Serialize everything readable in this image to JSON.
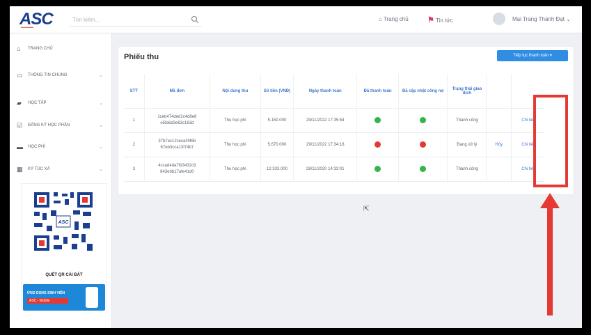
{
  "header": {
    "logo_text": "ASC",
    "search_placeholder": "Tìm kiếm...",
    "home_label": "Trang chủ",
    "news_label": "Tin tức",
    "user_name": "Mai Trang Thành Đạt"
  },
  "sidebar": {
    "items": [
      {
        "label": "Trang chủ",
        "icon": "home-icon",
        "has_chevron": false
      },
      {
        "label": "Thông tin chung",
        "icon": "monitor-icon",
        "has_chevron": true
      },
      {
        "label": "Học tập",
        "icon": "graduation-cap-icon",
        "has_chevron": true
      },
      {
        "label": "Đăng ký học phần",
        "icon": "register-icon",
        "has_chevron": true
      },
      {
        "label": "Học phí",
        "icon": "money-icon",
        "has_chevron": true
      },
      {
        "label": "Ký túc xá",
        "icon": "building-icon",
        "has_chevron": true
      }
    ],
    "qr_caption": "QUÉT QR CÀI ĐẶT",
    "banner_line1": "ỨNG DỤNG SINH VIÊN",
    "banner_line2": "ASC - Mobile"
  },
  "main": {
    "title": "Phiếu thu",
    "pay_button": "Tiếp tục thanh toán",
    "columns": [
      "STT",
      "Mã đơn",
      "Nội dung thu",
      "Số tiền (VNĐ)",
      "Ngày thanh toán",
      "Đã thanh toán",
      "Đã cập nhật công nợ",
      "Trạng thái giao dịch",
      "",
      ""
    ],
    "rows": [
      {
        "stt": "1",
        "code": "1ceb474ded2c4d8e8 e5fa6d3e63c163d",
        "content": "Thu học phí",
        "amount": "5.150.000",
        "date": "29/11/2022 17:35:54",
        "paid": "success",
        "updated": "success",
        "status": "Thành công",
        "extra": "",
        "action": "Chi tiết"
      },
      {
        "stt": "2",
        "code": "37b7ec12ceca4f46b 67eb3cca13f74b7",
        "content": "Thu học phí",
        "amount": "5.670.000",
        "date": "29/11/2022 17:34:18",
        "paid": "failed",
        "updated": "failed",
        "status": "Đang xử lý",
        "extra": "Hủy",
        "action": "Chi tiết"
      },
      {
        "stt": "3",
        "code": "4ccad4da7fd3432c9 843ebb17afe41d0",
        "content": "Thu học phí",
        "amount": "12.333.000",
        "date": "28/11/2020 14:33:01",
        "paid": "success",
        "updated": "success",
        "status": "Thành công",
        "extra": "",
        "action": "Chi tiết"
      }
    ]
  },
  "colors": {
    "success": "#36b34a",
    "failed": "#e53935",
    "accent": "#2f8de4",
    "annotation": "#e53935"
  }
}
